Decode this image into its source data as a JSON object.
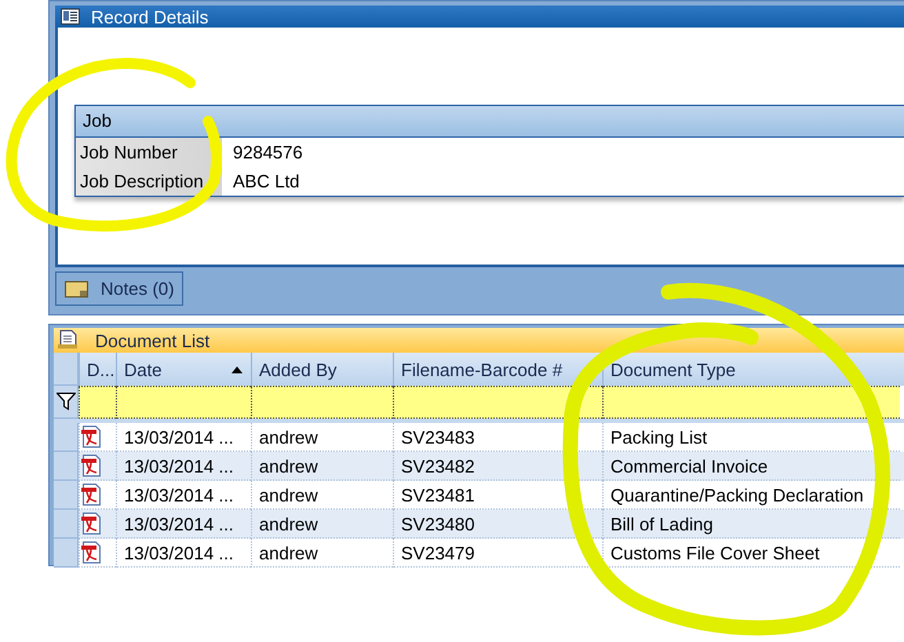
{
  "record_panel": {
    "title": "Record Details"
  },
  "job": {
    "heading": "Job",
    "fields": [
      {
        "label": "Job Number",
        "value": "9284576"
      },
      {
        "label": "Job Description",
        "value": "ABC Ltd"
      }
    ]
  },
  "notes_button": "Notes (0)",
  "document_list": {
    "title": "Document List",
    "columns": [
      {
        "label": "D..."
      },
      {
        "label": "Date",
        "sorted_ascending": true
      },
      {
        "label": "Added By"
      },
      {
        "label": "Filename-Barcode #"
      },
      {
        "label": "Document Type"
      }
    ],
    "rows": [
      {
        "date": "13/03/2014 ...",
        "added_by": "andrew",
        "barcode": "SV23483",
        "type": "Packing List"
      },
      {
        "date": "13/03/2014 ...",
        "added_by": "andrew",
        "barcode": "SV23482",
        "type": "Commercial Invoice"
      },
      {
        "date": "13/03/2014 ...",
        "added_by": "andrew",
        "barcode": "SV23481",
        "type": "Quarantine/Packing Declaration"
      },
      {
        "date": "13/03/2014 ...",
        "added_by": "andrew",
        "barcode": "SV23480",
        "type": "Bill of Lading"
      },
      {
        "date": "13/03/2014 ...",
        "added_by": "andrew",
        "barcode": "SV23479",
        "type": "Customs File Cover Sheet"
      }
    ]
  }
}
